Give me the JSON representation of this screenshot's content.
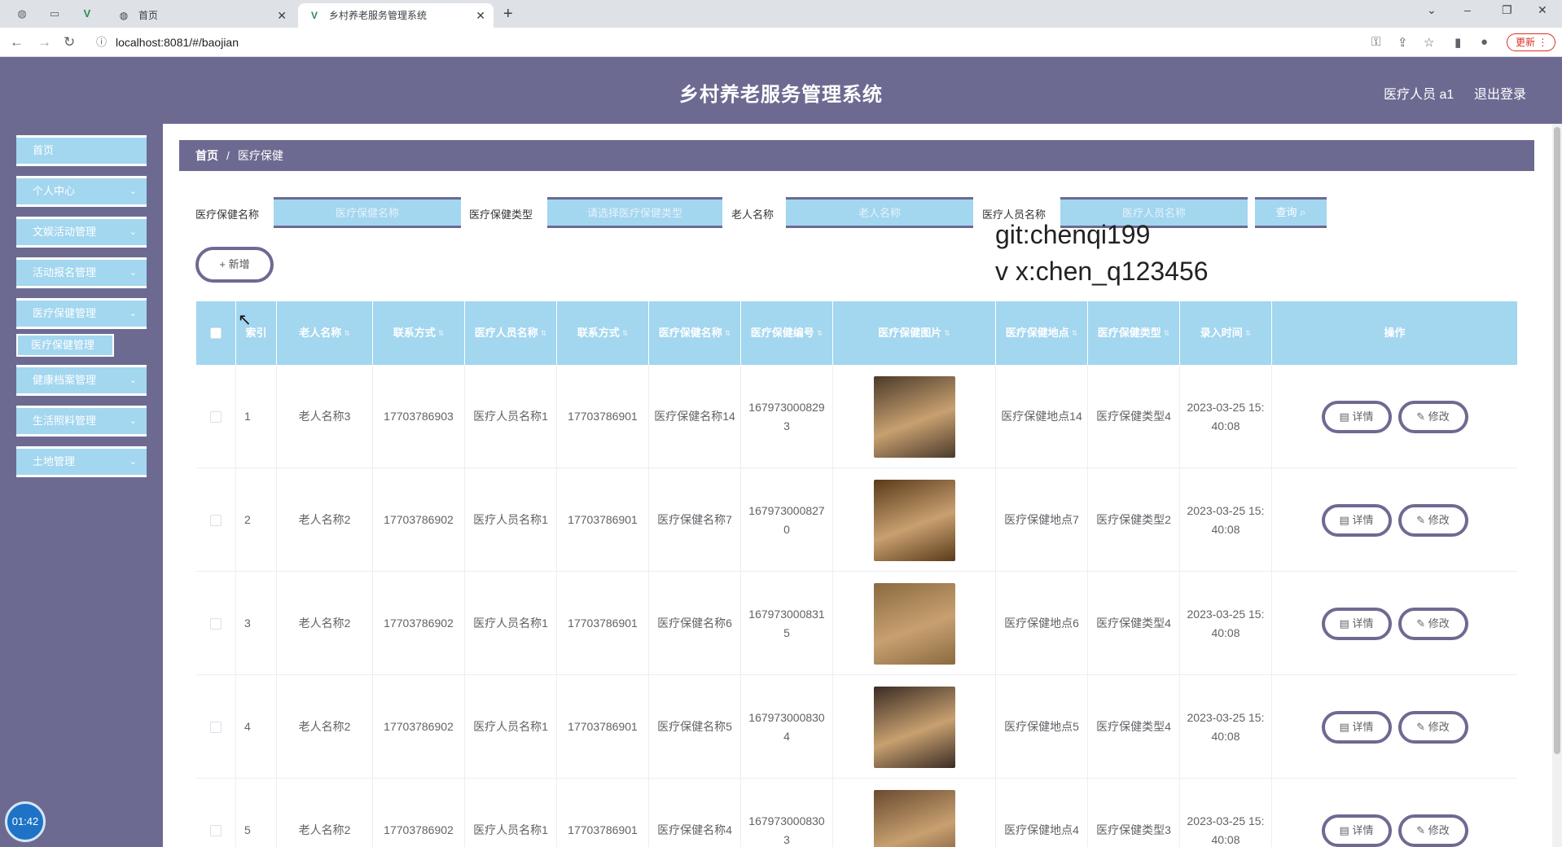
{
  "browser": {
    "tabs": [
      {
        "label": "首页",
        "active": false
      },
      {
        "label": "乡村养老服务管理系统",
        "active": true
      }
    ],
    "url": "localhost:8081/#/baojian",
    "update_label": "更新"
  },
  "header": {
    "title": "乡村养老服务管理系统",
    "user": "医疗人员 a1",
    "logout": "退出登录"
  },
  "sidebar": {
    "items": [
      {
        "label": "首页",
        "has_children": false
      },
      {
        "label": "个人中心",
        "has_children": true
      },
      {
        "label": "文娱活动管理",
        "has_children": true
      },
      {
        "label": "活动报名管理",
        "has_children": true
      },
      {
        "label": "医疗保健管理",
        "has_children": true
      },
      {
        "label": "健康档案管理",
        "has_children": true
      },
      {
        "label": "生活照料管理",
        "has_children": true
      },
      {
        "label": "土地管理",
        "has_children": true
      }
    ],
    "subitem": "医疗保健管理",
    "timer": "01:42"
  },
  "breadcrumb": {
    "home": "首页",
    "current": "医疗保健"
  },
  "filters": [
    {
      "label": "医疗保健名称",
      "placeholder": "医疗保健名称"
    },
    {
      "label": "医疗保健类型",
      "placeholder": "请选择医疗保健类型"
    },
    {
      "label": "老人名称",
      "placeholder": "老人名称"
    },
    {
      "label": "医疗人员名称",
      "placeholder": "医疗人员名称"
    }
  ],
  "search_label": "查询",
  "add_label": "新增",
  "watermark": {
    "line1": "git:chenqi199",
    "line2": "v x:chen_q123456"
  },
  "table": {
    "columns": [
      "索引",
      "老人名称",
      "联系方式",
      "医疗人员名称",
      "联系方式",
      "医疗保健名称",
      "医疗保健编号",
      "医疗保健图片",
      "医疗保健地点",
      "医疗保健类型",
      "录入时间",
      "操作"
    ],
    "detail_label": "详情",
    "edit_label": "修改",
    "rows": [
      {
        "index": "1",
        "elder": "老人名称3",
        "elder_phone": "17703786903",
        "staff": "医疗人员名称1",
        "staff_phone": "17703786901",
        "name": "医疗保健名称14",
        "code": "1679730008293",
        "place": "医疗保健地点14",
        "type": "医疗保健类型4",
        "time": "2023-03-25 15:40:08",
        "img_color": "#4a3a2a"
      },
      {
        "index": "2",
        "elder": "老人名称2",
        "elder_phone": "17703786902",
        "staff": "医疗人员名称1",
        "staff_phone": "17703786901",
        "name": "医疗保健名称7",
        "code": "1679730008270",
        "place": "医疗保健地点7",
        "type": "医疗保健类型2",
        "time": "2023-03-25 15:40:08",
        "img_color": "#5a3a1a"
      },
      {
        "index": "3",
        "elder": "老人名称2",
        "elder_phone": "17703786902",
        "staff": "医疗人员名称1",
        "staff_phone": "17703786901",
        "name": "医疗保健名称6",
        "code": "1679730008315",
        "place": "医疗保健地点6",
        "type": "医疗保健类型4",
        "time": "2023-03-25 15:40:08",
        "img_color": "#8a6a40"
      },
      {
        "index": "4",
        "elder": "老人名称2",
        "elder_phone": "17703786902",
        "staff": "医疗人员名称1",
        "staff_phone": "17703786901",
        "name": "医疗保健名称5",
        "code": "1679730008304",
        "place": "医疗保健地点5",
        "type": "医疗保健类型4",
        "time": "2023-03-25 15:40:08",
        "img_color": "#3a2c24"
      },
      {
        "index": "5",
        "elder": "老人名称2",
        "elder_phone": "17703786902",
        "staff": "医疗人员名称1",
        "staff_phone": "17703786901",
        "name": "医疗保健名称4",
        "code": "1679730008303",
        "place": "医疗保健地点4",
        "type": "医疗保健类型3",
        "time": "2023-03-25 15:40:08",
        "img_color": "#6a4a30"
      }
    ]
  },
  "colors": {
    "primary": "#6d6a92",
    "accent": "#a3d6ef"
  }
}
